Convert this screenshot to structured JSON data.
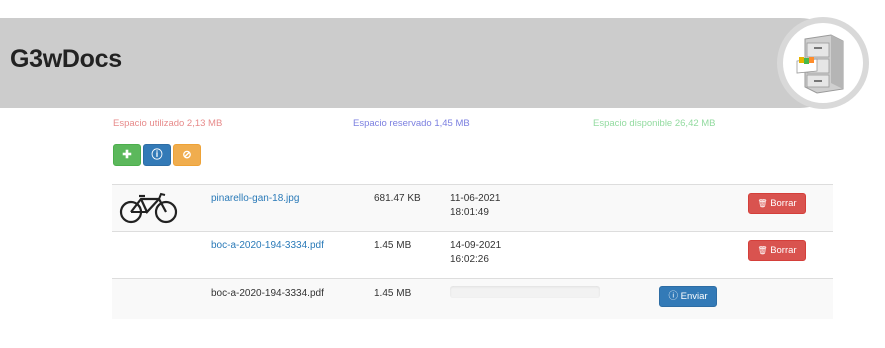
{
  "app": {
    "title": "G3wDocs",
    "logo_icon": "file-cabinet-icon"
  },
  "storage": {
    "used_label": "Espacio utilizado 2,13 MB",
    "reserved_label": "Espacio reservado 1,45 MB",
    "available_label": "Espacio disponible 26,42 MB",
    "colors": {
      "used": "#e78a8a",
      "reserved": "#7b7fe0",
      "available": "#93dba0"
    }
  },
  "toolbar": {
    "add_icon": "plus-icon",
    "add_glyph": "✚",
    "info_icon": "info-circle-icon",
    "info_glyph": "ⓘ",
    "cancel_icon": "ban-icon",
    "cancel_glyph": "⊘"
  },
  "files": [
    {
      "name": "pinarello-gan-18.jpg",
      "size": "681.47 KB",
      "date": "11-06-2021",
      "time": "18:01:49",
      "thumbnail": "bicycle-thumbnail",
      "action": "Borrar"
    },
    {
      "name": "boc-a-2020-194-3334.pdf",
      "size": "1.45 MB",
      "date": "14-09-2021",
      "time": "16:02:26",
      "action": "Borrar"
    }
  ],
  "upload": {
    "name": "boc-a-2020-194-3334.pdf",
    "size": "1.45 MB",
    "progress": 0,
    "action": "Enviar"
  },
  "icons": {
    "trash": "trash-icon",
    "trash_glyph": "🗑",
    "upload": "info-circle-icon",
    "upload_glyph": "ⓘ"
  }
}
